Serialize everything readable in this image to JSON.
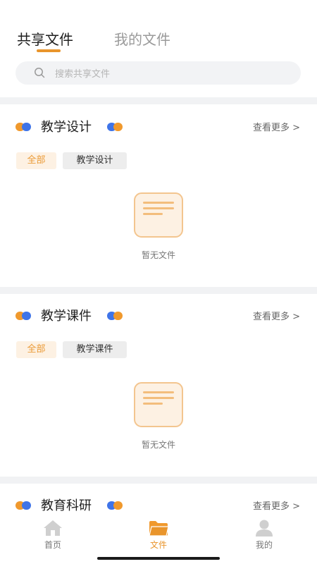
{
  "tabs": {
    "shared": "共享文件",
    "mine": "我的文件"
  },
  "search": {
    "placeholder": "搜索共享文件"
  },
  "sections": [
    {
      "title": "教学设计",
      "more": "查看更多 >",
      "tag_all": "全部",
      "tag_category": "教学设计",
      "empty_text": "暂无文件"
    },
    {
      "title": "教学课件",
      "more": "查看更多 >",
      "tag_all": "全部",
      "tag_category": "教学课件",
      "empty_text": "暂无文件"
    },
    {
      "title": "教育科研",
      "more": "查看更多 >"
    }
  ],
  "nav": {
    "home": "首页",
    "files": "文件",
    "mine": "我的"
  },
  "colors": {
    "accent": "#e9952c",
    "dot_blue": "#3f74e8",
    "dot_orange": "#f0992d"
  },
  "icons": {
    "search": "search-icon",
    "empty": "empty-document-icon",
    "home": "home-icon",
    "files": "folder-icon",
    "mine": "user-icon"
  }
}
